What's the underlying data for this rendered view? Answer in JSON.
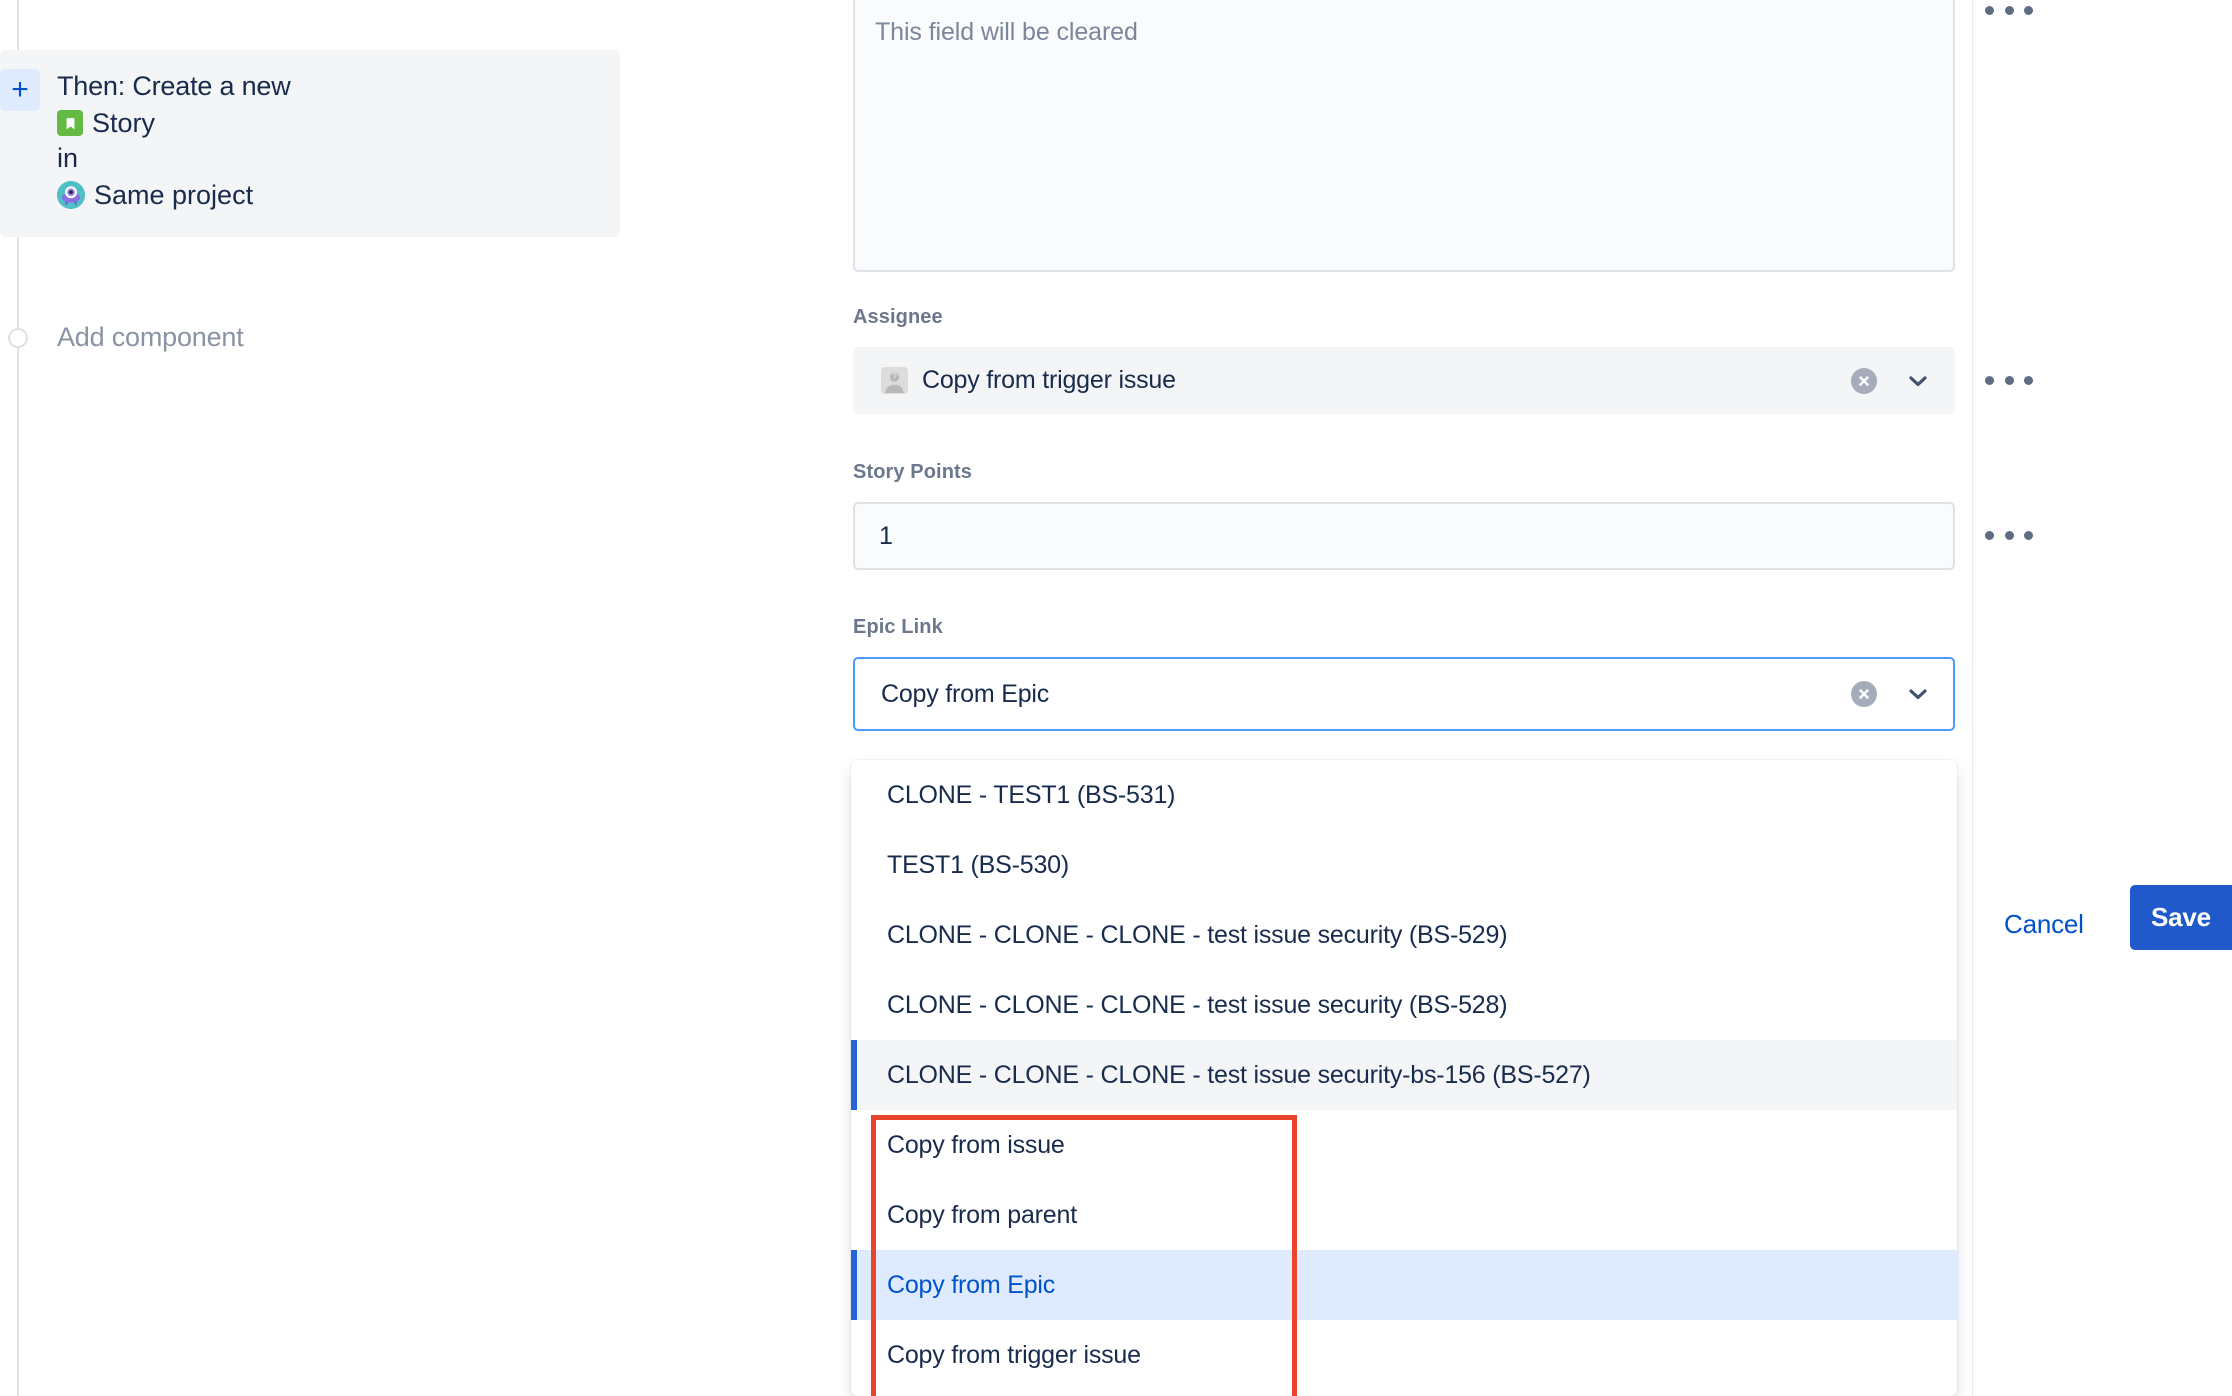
{
  "rule": {
    "add_icon": "plus-icon",
    "title": "Then: Create a new",
    "issue_type": "Story",
    "connector": "in",
    "project": "Same project",
    "add_component_label": "Add component"
  },
  "form": {
    "description_placeholder": "This field will be cleared",
    "fields": [
      {
        "label": "Assignee",
        "value": "Copy from trigger issue"
      },
      {
        "label": "Story Points",
        "value": "1"
      },
      {
        "label": "Epic Link",
        "value": "Copy from Epic"
      }
    ],
    "more_menu_icon": "ellipsis-horizontal-icon",
    "clear_icon": "clear-circle-icon",
    "chevron_icon": "chevron-down-icon"
  },
  "dropdown": {
    "options": [
      {
        "label": "CLONE - TEST1 (BS-531)",
        "state": "normal"
      },
      {
        "label": "TEST1 (BS-530)",
        "state": "normal"
      },
      {
        "label": "CLONE - CLONE - CLONE - test issue security (BS-529)",
        "state": "normal"
      },
      {
        "label": "CLONE - CLONE - CLONE - test issue security (BS-528)",
        "state": "normal"
      },
      {
        "label": "CLONE - CLONE - CLONE - test issue security-bs-156 (BS-527)",
        "state": "hovered"
      },
      {
        "label": "Copy from issue",
        "state": "normal"
      },
      {
        "label": "Copy from parent",
        "state": "normal"
      },
      {
        "label": "Copy from Epic",
        "state": "selected"
      },
      {
        "label": "Copy from trigger issue",
        "state": "normal"
      }
    ]
  },
  "actions": {
    "cancel_label": "Cancel",
    "save_label": "Save"
  },
  "colors": {
    "accent": "#0052cc",
    "save_button": "#2059c9",
    "focus_border": "#4c9aff",
    "selected_row": "#deebff",
    "annotation": "#e8452c",
    "story_icon": "#65ba43"
  }
}
